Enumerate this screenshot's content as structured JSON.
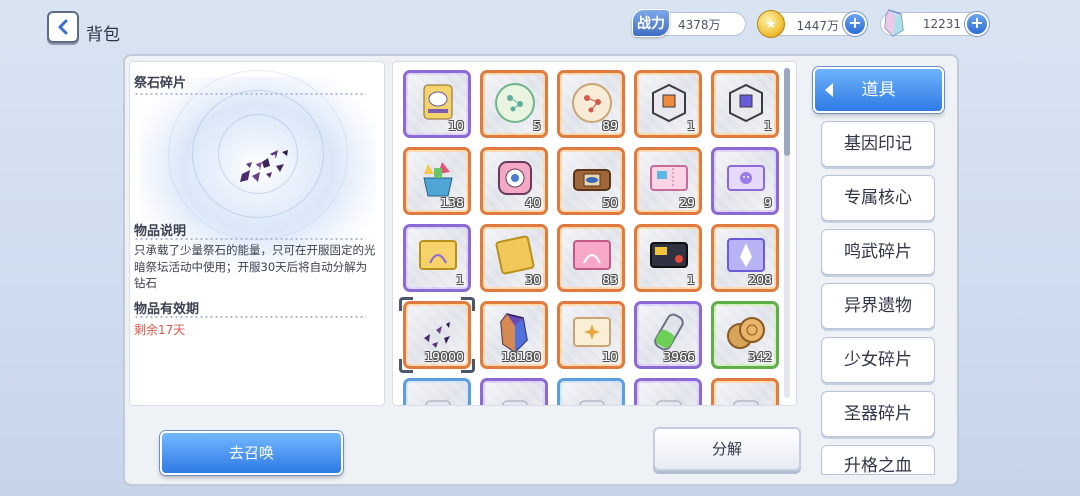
{
  "header": {
    "title": "背包",
    "power_badge": "战力",
    "power_value": "4378万",
    "gold_value": "1447万",
    "gem_value": "12231"
  },
  "item_detail": {
    "name": "祭石碎片",
    "desc_heading": "物品说明",
    "desc_text": "只承载了少量祭石的能量，只可在开服固定的光暗祭坛活动中使用；开服30天后将自动分解为钻石",
    "expiry_heading": "物品有效期",
    "expiry_value": "剩余17天"
  },
  "inventory": {
    "items": [
      {
        "icon": "scroll-icon",
        "count": "10",
        "rarity": "purple"
      },
      {
        "icon": "green-orb-icon",
        "count": "5",
        "rarity": "orange"
      },
      {
        "icon": "pearl-orb-icon",
        "count": "89",
        "rarity": "orange"
      },
      {
        "icon": "dice-box-icon",
        "count": "1",
        "rarity": "orange"
      },
      {
        "icon": "dice-box-purple-icon",
        "count": "1",
        "rarity": "orange"
      },
      {
        "icon": "gift-basket-icon",
        "count": "138",
        "rarity": "orange"
      },
      {
        "icon": "pink-device-icon",
        "count": "40",
        "rarity": "orange"
      },
      {
        "icon": "chest-icon",
        "count": "50",
        "rarity": "orange"
      },
      {
        "icon": "ticket-icon",
        "count": "29",
        "rarity": "orange"
      },
      {
        "icon": "smile-ticket-icon",
        "count": "9",
        "rarity": "purple"
      },
      {
        "icon": "gold-dna-card-icon",
        "count": "1",
        "rarity": "purple"
      },
      {
        "icon": "gold-card-icon",
        "count": "30",
        "rarity": "orange"
      },
      {
        "icon": "pink-dna-card-icon",
        "count": "83",
        "rarity": "orange"
      },
      {
        "icon": "black-card-icon",
        "count": "1",
        "rarity": "orange"
      },
      {
        "icon": "rocket-card-icon",
        "count": "208",
        "rarity": "orange"
      },
      {
        "icon": "shard-icon",
        "count": "19000",
        "rarity": "orange"
      },
      {
        "icon": "crystal-icon",
        "count": "18180",
        "rarity": "orange"
      },
      {
        "icon": "star-card-icon",
        "count": "10",
        "rarity": "orange"
      },
      {
        "icon": "green-vial-icon",
        "count": "3966",
        "rarity": "purple"
      },
      {
        "icon": "coin-stack-icon",
        "count": "342",
        "rarity": "green"
      },
      {
        "icon": "partial-item-icon",
        "count": "",
        "rarity": "blue"
      },
      {
        "icon": "partial-item-icon",
        "count": "",
        "rarity": "purple"
      },
      {
        "icon": "partial-item-icon",
        "count": "",
        "rarity": "blue"
      },
      {
        "icon": "partial-item-icon",
        "count": "",
        "rarity": "purple"
      },
      {
        "icon": "partial-item-icon",
        "count": "",
        "rarity": "orange"
      }
    ]
  },
  "tabs": [
    {
      "label": "道具",
      "active": true
    },
    {
      "label": "基因印记"
    },
    {
      "label": "专属核心"
    },
    {
      "label": "鸣武碎片"
    },
    {
      "label": "异界遗物"
    },
    {
      "label": "少女碎片"
    },
    {
      "label": "圣器碎片"
    },
    {
      "label": "升格之血"
    }
  ],
  "buttons": {
    "summon": "去召唤",
    "split": "分解"
  }
}
